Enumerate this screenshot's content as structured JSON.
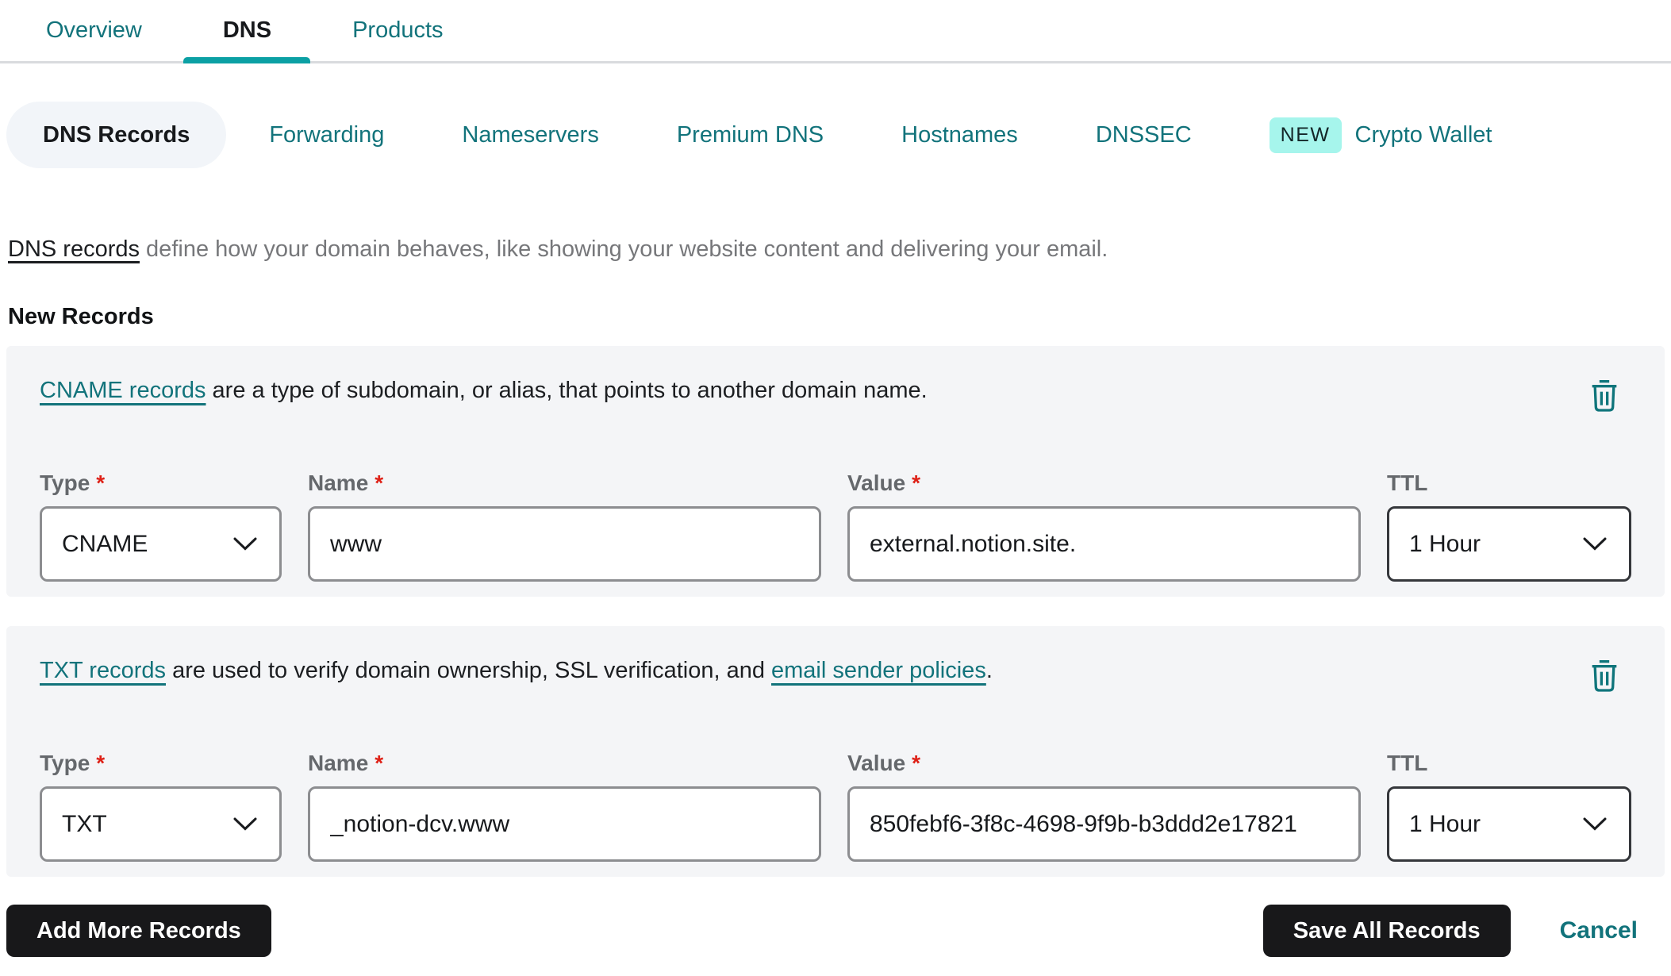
{
  "tabs": [
    {
      "label": "Overview",
      "active": false
    },
    {
      "label": "DNS",
      "active": true
    },
    {
      "label": "Products",
      "active": false
    }
  ],
  "subtabs": [
    {
      "label": "DNS Records",
      "active": true
    },
    {
      "label": "Forwarding"
    },
    {
      "label": "Nameservers"
    },
    {
      "label": "Premium DNS"
    },
    {
      "label": "Hostnames"
    },
    {
      "label": "DNSSEC"
    },
    {
      "label": "Crypto Wallet",
      "badge": "NEW"
    }
  ],
  "intro": {
    "link": "DNS records",
    "text": " define how your domain behaves, like showing your website content and delivering your email."
  },
  "section_heading": "New Records",
  "ui": {
    "required_marker": "*"
  },
  "records": [
    {
      "desc": {
        "link": "CNAME records",
        "text": " are a type of subdomain, or alias, that points to another domain name."
      },
      "type": {
        "label": "Type",
        "value": "CNAME"
      },
      "name": {
        "label": "Name",
        "value": "www"
      },
      "value": {
        "label": "Value",
        "value": "external.notion.site."
      },
      "ttl": {
        "label": "TTL",
        "value": "1 Hour"
      }
    },
    {
      "desc": {
        "link": "TXT records",
        "text": " are used to verify domain ownership, SSL verification, and ",
        "link2": "email sender policies",
        "text2": "."
      },
      "type": {
        "label": "Type",
        "value": "TXT"
      },
      "name": {
        "label": "Name",
        "value": "_notion-dcv.www"
      },
      "value": {
        "label": "Value",
        "value": "850febf6-3f8c-4698-9f9b-b3ddd2e17821"
      },
      "ttl": {
        "label": "TTL",
        "value": "1 Hour"
      }
    }
  ],
  "actions": {
    "add": "Add More Records",
    "save": "Save All Records",
    "cancel": "Cancel"
  },
  "colors": {
    "teal_link": "#12737b",
    "accent_teal": "#0ba0a4",
    "badge_bg": "#a6f5ec",
    "card_bg": "#f4f5f7",
    "pill_bg": "#f2f5f9",
    "field_border": "#8c8d90",
    "ttl_field_border": "#35373b",
    "required_red": "#de2016",
    "button_bg": "#18181a"
  }
}
